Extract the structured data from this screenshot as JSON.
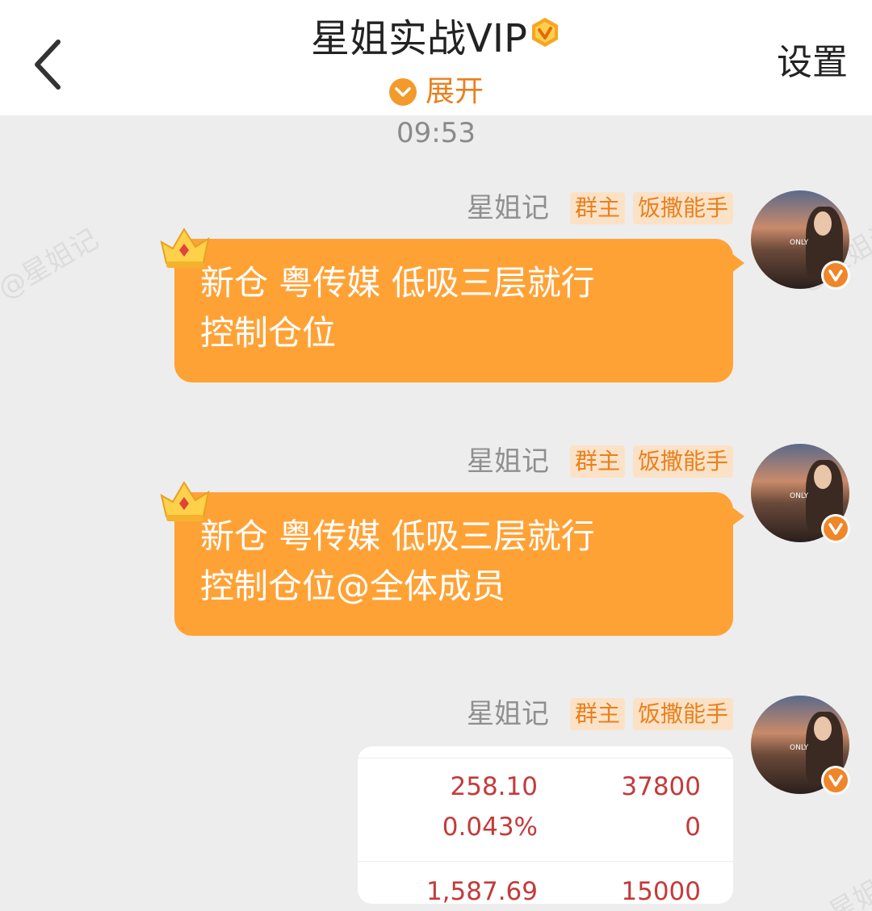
{
  "header": {
    "title": "星姐实战VIP",
    "expand_label": "展开",
    "settings_label": "设置"
  },
  "time": "09:53",
  "watermark": "@星姐记",
  "messages": [
    {
      "sender": "星姐记",
      "tags": [
        "群主",
        "饭撒能手"
      ],
      "line1": "新仓 粤传媒  低吸三层就行",
      "line2": "控制仓位"
    },
    {
      "sender": "星姐记",
      "tags": [
        "群主",
        "饭撒能手"
      ],
      "line1": "新仓 粤传媒  低吸三层就行",
      "line2": "控制仓位@全体成员"
    },
    {
      "sender": "星姐记",
      "tags": [
        "群主",
        "饭撒能手"
      ],
      "card": {
        "row1": [
          "258.10",
          "37800"
        ],
        "row2": [
          "0.043%",
          "0"
        ],
        "row3": [
          "1,587.69",
          "15000"
        ]
      }
    }
  ],
  "avatar_sign": "ONLY",
  "colors": {
    "accent": "#ffa236",
    "tag_text": "#e8801f",
    "tag_bg": "#fbe2c6",
    "price_red": "#c43a3a"
  }
}
